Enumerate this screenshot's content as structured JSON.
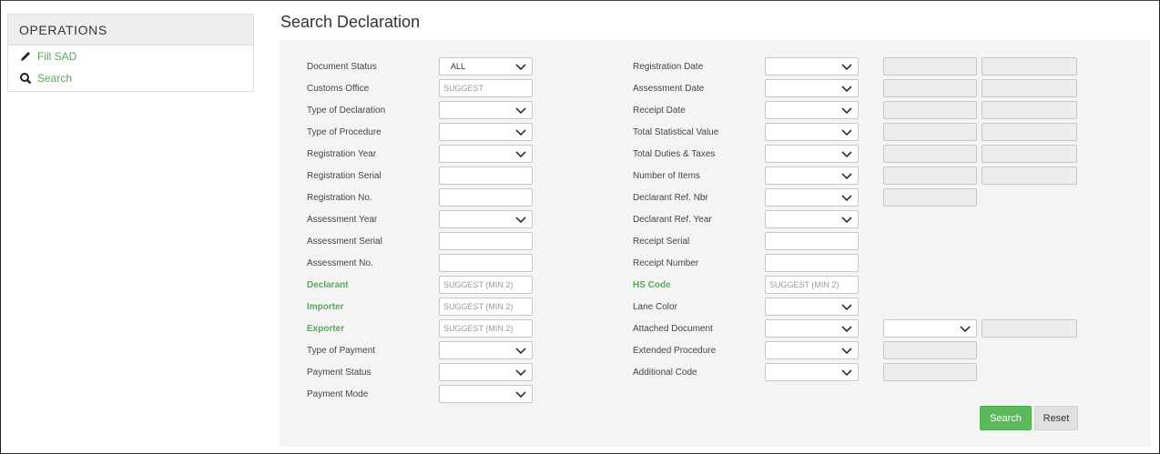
{
  "sidebar": {
    "heading": "OPERATIONS",
    "items": [
      {
        "label": "Fill SAD",
        "icon": "pencil-icon"
      },
      {
        "label": "Search",
        "icon": "search-icon"
      }
    ]
  },
  "page_title": "Search Declaration",
  "left_fields": {
    "document_status": {
      "label": "Document Status",
      "value": "ALL"
    },
    "customs_office": {
      "label": "Customs Office",
      "placeholder": "SUGGEST"
    },
    "type_of_declaration": {
      "label": "Type of Declaration"
    },
    "type_of_procedure": {
      "label": "Type of Procedure"
    },
    "registration_year": {
      "label": "Registration Year"
    },
    "registration_serial": {
      "label": "Registration Serial"
    },
    "registration_no": {
      "label": "Registration No."
    },
    "assessment_year": {
      "label": "Assessment Year"
    },
    "assessment_serial": {
      "label": "Assessment Serial"
    },
    "assessment_no": {
      "label": "Assessment No."
    },
    "declarant": {
      "label": "Declarant",
      "placeholder": "SUGGEST (MIN 2)"
    },
    "importer": {
      "label": "Importer",
      "placeholder": "SUGGEST (MIN 2)"
    },
    "exporter": {
      "label": "Exporter",
      "placeholder": "SUGGEST (MIN 2)"
    },
    "type_of_payment": {
      "label": "Type of Payment"
    },
    "payment_status": {
      "label": "Payment Status"
    },
    "payment_mode": {
      "label": "Payment Mode"
    }
  },
  "right_fields": {
    "registration_date": {
      "label": "Registration Date"
    },
    "assessment_date": {
      "label": "Assessment Date"
    },
    "receipt_date": {
      "label": "Receipt Date"
    },
    "total_statistical_value": {
      "label": "Total Statistical Value"
    },
    "total_duties_taxes": {
      "label": "Total Duties & Taxes"
    },
    "number_of_items": {
      "label": "Number of Items"
    },
    "declarant_ref_nbr": {
      "label": "Declarant Ref. Nbr"
    },
    "declarant_ref_year": {
      "label": "Declarant Ref. Year"
    },
    "receipt_serial": {
      "label": "Receipt Serial"
    },
    "receipt_number": {
      "label": "Receipt Number"
    },
    "hs_code": {
      "label": "HS Code",
      "placeholder": "SUGGEST (MIN 2)"
    },
    "lane_color": {
      "label": "Lane Color"
    },
    "attached_document": {
      "label": "Attached Document"
    },
    "extended_procedure": {
      "label": "Extended Procedure"
    },
    "additional_code": {
      "label": "Additional Code"
    }
  },
  "buttons": {
    "search": "Search",
    "reset": "Reset"
  },
  "colors": {
    "accent_green": "#5cb85c",
    "panel_bg": "#f4f4f4"
  }
}
